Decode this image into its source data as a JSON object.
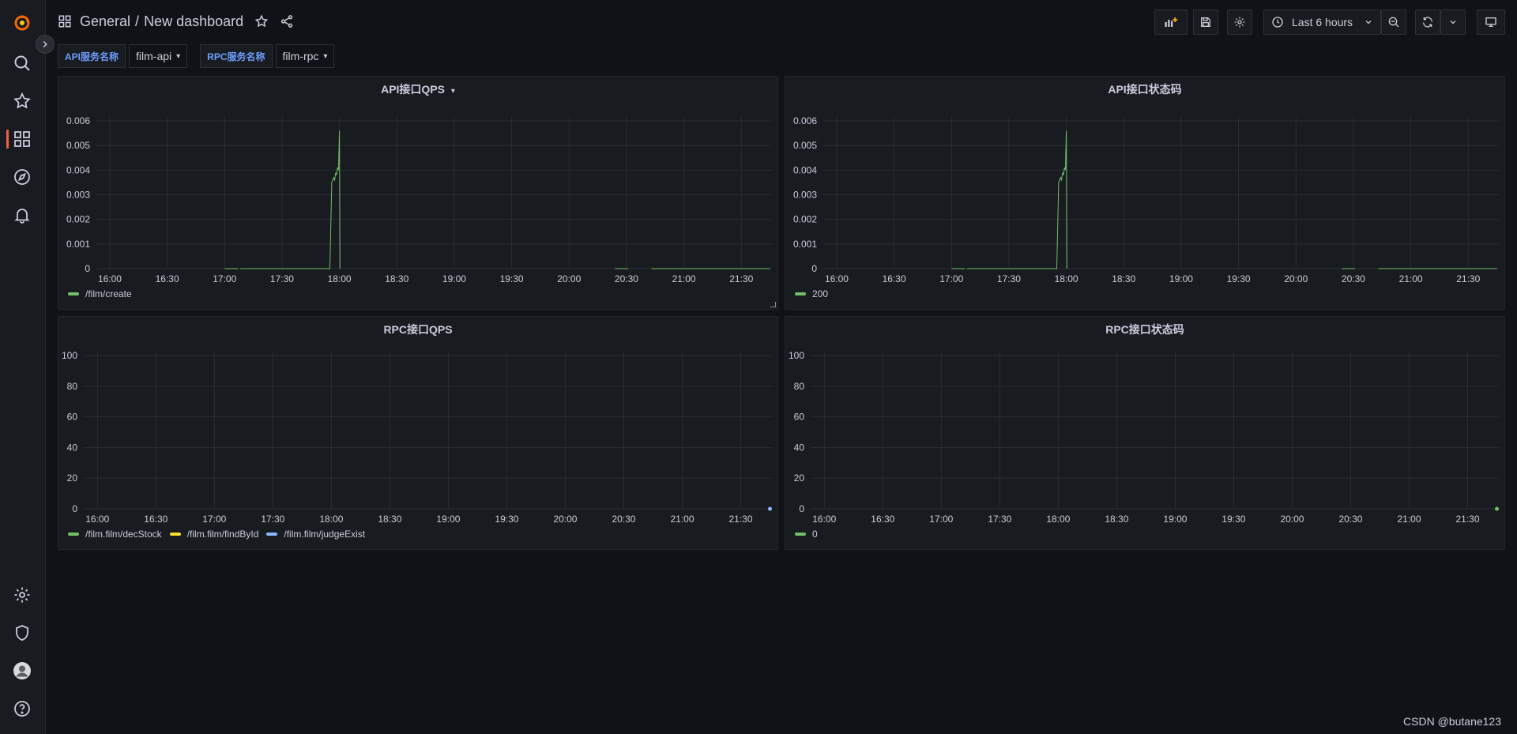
{
  "breadcrumb": {
    "folder": "General",
    "separator": "/",
    "dashboard": "New dashboard"
  },
  "toolbar": {
    "time_range": "Last 6 hours"
  },
  "variables": [
    {
      "label": "API服务名称",
      "value": "film-api"
    },
    {
      "label": "RPC服务名称",
      "value": "film-rpc"
    }
  ],
  "colors": {
    "green": "#73bf69",
    "yellow": "#fade2a",
    "blue": "#8ab8ff",
    "accent": "#f55f3e"
  },
  "watermark": "CSDN @butane123",
  "chart_data": [
    {
      "type": "line",
      "title": "API接口QPS",
      "x_ticks": [
        "16:00",
        "16:30",
        "17:00",
        "17:30",
        "18:00",
        "18:30",
        "19:00",
        "19:30",
        "20:00",
        "20:30",
        "21:00",
        "21:30"
      ],
      "y_ticks": [
        "0",
        "0.001",
        "0.002",
        "0.003",
        "0.004",
        "0.005",
        "0.006"
      ],
      "ylim": [
        0,
        0.006
      ],
      "xlim": [
        "15:53",
        "21:46"
      ],
      "series": [
        {
          "name": "/film/create",
          "color": "#73bf69",
          "segments": [
            [
              [
                "17:00",
                0
              ],
              [
                "17:07",
                0
              ]
            ],
            [
              [
                "17:08",
                0
              ],
              [
                "17:55",
                0
              ],
              [
                "17:56",
                0.0035
              ],
              [
                "17:57",
                0.0037
              ],
              [
                "17:57.5",
                0.0036
              ],
              [
                "17:58",
                0.0039
              ],
              [
                "17:58.5",
                0.0038
              ],
              [
                "17:59",
                0.0041
              ],
              [
                "17:59.5",
                0.004
              ],
              [
                "18:00",
                0.0056
              ],
              [
                "18:00.3",
                0
              ]
            ],
            [
              [
                "20:24",
                0
              ],
              [
                "20:31",
                0
              ]
            ],
            [
              [
                "20:43",
                0
              ],
              [
                "21:45",
                0
              ]
            ]
          ]
        }
      ]
    },
    {
      "type": "line",
      "title": "API接口状态码",
      "x_ticks": [
        "16:00",
        "16:30",
        "17:00",
        "17:30",
        "18:00",
        "18:30",
        "19:00",
        "19:30",
        "20:00",
        "20:30",
        "21:00",
        "21:30"
      ],
      "y_ticks": [
        "0",
        "0.001",
        "0.002",
        "0.003",
        "0.004",
        "0.005",
        "0.006"
      ],
      "ylim": [
        0,
        0.006
      ],
      "xlim": [
        "15:53",
        "21:46"
      ],
      "series": [
        {
          "name": "200",
          "color": "#73bf69",
          "segments": [
            [
              [
                "17:00",
                0
              ],
              [
                "17:07",
                0
              ]
            ],
            [
              [
                "17:08",
                0
              ],
              [
                "17:55",
                0
              ],
              [
                "17:56",
                0.0035
              ],
              [
                "17:57",
                0.0037
              ],
              [
                "17:57.5",
                0.0036
              ],
              [
                "17:58",
                0.0039
              ],
              [
                "17:58.5",
                0.0038
              ],
              [
                "17:59",
                0.0041
              ],
              [
                "17:59.5",
                0.004
              ],
              [
                "18:00",
                0.0056
              ],
              [
                "18:00.3",
                0
              ]
            ],
            [
              [
                "20:24",
                0
              ],
              [
                "20:31",
                0
              ]
            ],
            [
              [
                "20:43",
                0
              ],
              [
                "21:45",
                0
              ]
            ]
          ]
        }
      ]
    },
    {
      "type": "line",
      "title": "RPC接口QPS",
      "x_ticks": [
        "16:00",
        "16:30",
        "17:00",
        "17:30",
        "18:00",
        "18:30",
        "19:00",
        "19:30",
        "20:00",
        "20:30",
        "21:00",
        "21:30"
      ],
      "y_ticks": [
        "0",
        "20",
        "40",
        "60",
        "80",
        "100"
      ],
      "ylim": [
        0,
        100
      ],
      "xlim": [
        "15:53",
        "21:46"
      ],
      "series": [
        {
          "name": "/film.film/decStock",
          "color": "#73bf69",
          "points": []
        },
        {
          "name": "/film.film/findById",
          "color": "#fade2a",
          "points": []
        },
        {
          "name": "/film.film/judgeExist",
          "color": "#8ab8ff",
          "points": [
            [
              "21:45",
              0
            ]
          ]
        }
      ]
    },
    {
      "type": "line",
      "title": "RPC接口状态码",
      "x_ticks": [
        "16:00",
        "16:30",
        "17:00",
        "17:30",
        "18:00",
        "18:30",
        "19:00",
        "19:30",
        "20:00",
        "20:30",
        "21:00",
        "21:30"
      ],
      "y_ticks": [
        "0",
        "20",
        "40",
        "60",
        "80",
        "100"
      ],
      "ylim": [
        0,
        100
      ],
      "xlim": [
        "15:53",
        "21:46"
      ],
      "series": [
        {
          "name": "0",
          "color": "#73bf69",
          "points": [
            [
              "21:45",
              0
            ]
          ]
        }
      ]
    }
  ]
}
